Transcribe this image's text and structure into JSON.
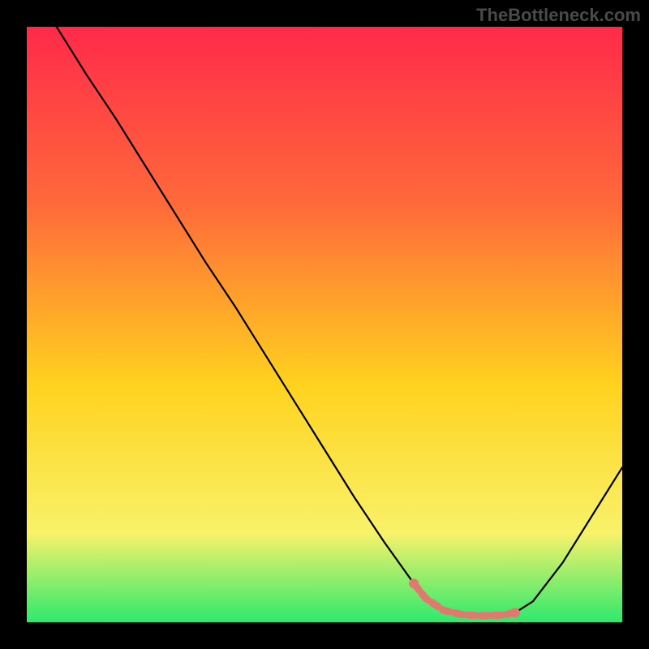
{
  "watermark": "TheBottleneck.com",
  "chart_data": {
    "type": "line",
    "title": "",
    "xlabel": "",
    "ylabel": "",
    "xlim": [
      0,
      100
    ],
    "ylim": [
      0,
      100
    ],
    "gradient_background": {
      "top": "#ff2a4a",
      "upper_mid": "#ff6a3a",
      "mid": "#ffd21e",
      "lower_mid": "#f8f26a",
      "bottom": "#2ee96d"
    },
    "curve": {
      "x": [
        5,
        10,
        15,
        20,
        25,
        30,
        35,
        40,
        45,
        50,
        55,
        60,
        65,
        67,
        70,
        73,
        76,
        80,
        82,
        85,
        90,
        95,
        100
      ],
      "y": [
        100,
        92,
        84.5,
        76.5,
        68.5,
        60.5,
        53,
        45,
        37,
        29,
        21,
        13.5,
        6.5,
        4,
        2,
        1.3,
        1.1,
        1.2,
        1.6,
        3.5,
        10,
        18,
        26
      ]
    },
    "markers": {
      "x": [
        65,
        67,
        70,
        73,
        76,
        80,
        82
      ],
      "y": [
        6.5,
        4,
        2,
        1.3,
        1.1,
        1.2,
        1.6
      ],
      "color": "#e07a6f"
    }
  }
}
